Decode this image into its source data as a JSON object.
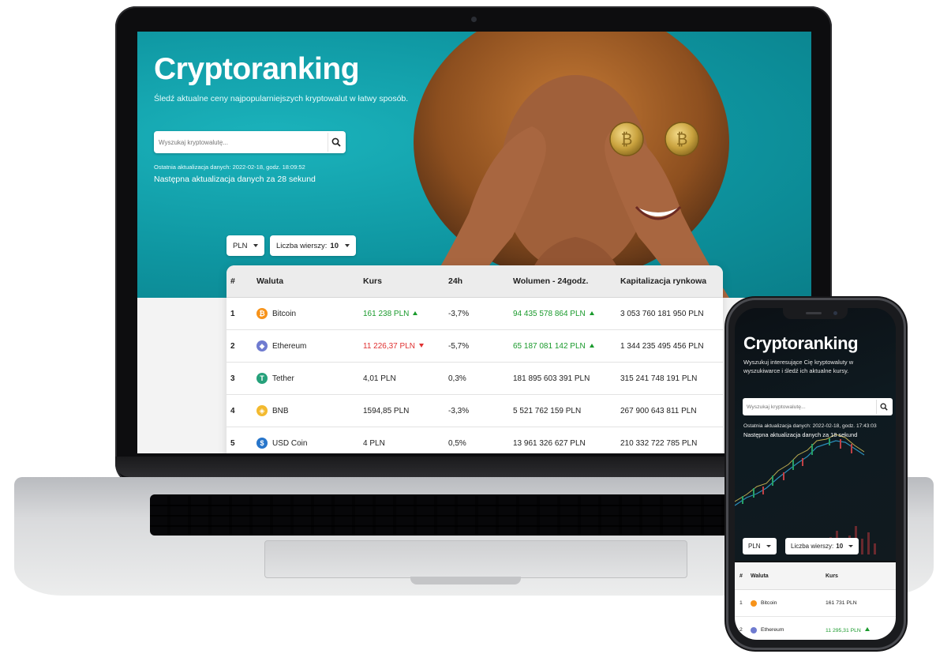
{
  "laptop": {
    "title": "Cryptoranking",
    "subtitle": "Śledź aktualne ceny najpopularniejszych kryptowalut w łatwy sposób.",
    "search_placeholder": "Wyszukaj kryptowalutę...",
    "last_update": "Ostatnia aktualizacja danych: 2022-02-18, godz. 18:09:52",
    "next_update": "Następna aktualizacja danych za 28 sekund",
    "currency": "PLN",
    "rows_label": "Liczba wierszy:",
    "rows_value": "10",
    "table": {
      "headers": [
        "#",
        "Waluta",
        "Kurs",
        "24h",
        "Wolumen - 24godz.",
        "Kapitalizacja rynkowa"
      ],
      "rows": [
        {
          "num": "1",
          "name": "Bitcoin",
          "icon": "bitcoin-icon",
          "icon_color": "#f7931a",
          "rate": "161 238 PLN",
          "rate_dir": "up",
          "change": "-3,7%",
          "volume": "94 435 578 864 PLN",
          "volume_dir": "up",
          "cap": "3 053 760 181 950 PLN"
        },
        {
          "num": "2",
          "name": "Ethereum",
          "icon": "ethereum-icon",
          "icon_color": "#6f7bd0",
          "rate": "11 226,37 PLN",
          "rate_dir": "down",
          "change": "-5,7%",
          "volume": "65 187 081 142 PLN",
          "volume_dir": "up",
          "cap": "1 344 235 495 456 PLN"
        },
        {
          "num": "3",
          "name": "Tether",
          "icon": "tether-icon",
          "icon_color": "#26a17b",
          "rate": "4,01 PLN",
          "rate_dir": "none",
          "change": "0,3%",
          "volume": "181 895 603 391 PLN",
          "volume_dir": "none",
          "cap": "315 241 748 191 PLN"
        },
        {
          "num": "4",
          "name": "BNB",
          "icon": "bnb-icon",
          "icon_color": "#f3ba2f",
          "rate": "1594,85 PLN",
          "rate_dir": "none",
          "change": "-3,3%",
          "volume": "5 521 762 159 PLN",
          "volume_dir": "none",
          "cap": "267 900 643 811 PLN"
        },
        {
          "num": "5",
          "name": "USD Coin",
          "icon": "usd-coin-icon",
          "icon_color": "#2775ca",
          "rate": "4 PLN",
          "rate_dir": "none",
          "change": "0,5%",
          "volume": "13 961 326 627 PLN",
          "volume_dir": "none",
          "cap": "210 332 722 785 PLN"
        }
      ]
    }
  },
  "phone": {
    "title": "Cryptoranking",
    "subtitle": "Wyszukuj interesujące Cię kryptowaluty w wyszukiwarce i śledź ich aktualne kursy.",
    "search_placeholder": "Wyszukaj kryptowalutę...",
    "last_update": "Ostatnia aktualizacja danych: 2022-02-18, godz. 17:43:03",
    "next_update": "Następna aktualizacja danych za 18 sekund",
    "currency": "PLN",
    "rows_label": "Liczba wierszy:",
    "rows_value": "10",
    "table": {
      "headers": [
        "#",
        "Waluta",
        "Kurs"
      ],
      "rows": [
        {
          "num": "1",
          "name": "Bitcoin",
          "icon_color": "#f7931a",
          "rate": "161 731 PLN",
          "rate_dir": "none"
        },
        {
          "num": "2",
          "name": "Ethereum",
          "icon_color": "#6f7bd0",
          "rate": "11 295,31 PLN",
          "rate_dir": "up"
        }
      ]
    }
  },
  "colors": {
    "accent_teal": "#0e95a0",
    "up_green": "#1a9a2c",
    "down_red": "#e03131"
  }
}
